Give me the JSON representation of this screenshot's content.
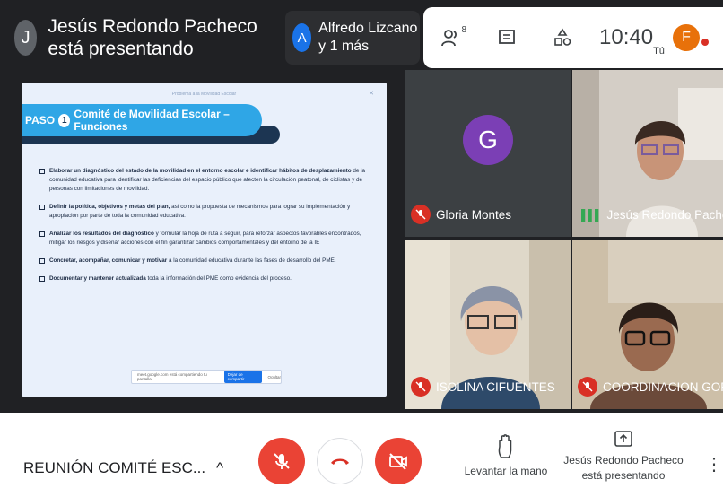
{
  "header": {
    "presenter_initial": "J",
    "presenter_text": "Jesús Redondo Pacheco está presentando",
    "other_initial": "A",
    "other_text": "Alfredo Lizcano y 1 más",
    "participants_count": "8",
    "time": "10:40",
    "self_initial": "F",
    "self_label": "Tú"
  },
  "slide": {
    "top_text": "Problema a la Movilidad Escolar",
    "paso_label": "PASO",
    "paso_number": "1",
    "paso_title": "Comité de Movilidad Escolar – Funciones",
    "bullets": [
      {
        "bold": "Elaborar un diagnóstico del estado de la movilidad en el entorno escolar e identificar hábitos de desplazamiento",
        "text": " de la comunidad educativa para identificar las deficiencias del espacio público que afecten la circulación peatonal, de ciclistas y de personas con limitaciones de movilidad."
      },
      {
        "bold": "Definir la política, objetivos y metas del plan,",
        "text": " así como la propuesta de mecanismos para lograr su implementación y apropiación por parte de toda la comunidad educativa."
      },
      {
        "bold": "Analizar los resultados del diagnóstico",
        "text": " y formular la hoja de ruta a seguir, para reforzar aspectos favorables encontrados, mitigar los riesgos y diseñar acciones con el fin garantizar cambios comportamentales y del entorno de la IE"
      },
      {
        "bold": "Concretar, acompañar, comunicar y motivar",
        "text": " a la comunidad educativa durante las fases de desarrollo del PME."
      },
      {
        "bold": "Documentar y mantener actualizada",
        "text": " toda la información del PME como evidencia del proceso."
      }
    ],
    "ctrl_text": "meet.google.com está compartiendo tu pantalla.",
    "ctrl_stop": "Dejar de compartir",
    "ctrl_hide": "Ocultar"
  },
  "tiles": {
    "gloria_initial": "G",
    "gloria_name": "Gloria Montes",
    "jesus_name": "Jesús Redondo Pacheco",
    "isolina_name": "ISOLINA CIFUENTES",
    "coord_name": "COORDINACION GORE..."
  },
  "bottom": {
    "meeting_name": "REUNIÓN COMITÉ ESC...",
    "chevron": "^",
    "raise_hand": "Levantar la mano",
    "present_line1": "Jesús Redondo Pacheco",
    "present_line2": "está presentando",
    "more": "⋮"
  },
  "colors": {
    "accent": "#1a73e8",
    "danger": "#ea4335",
    "slide_bar": "#2fa6e6"
  }
}
